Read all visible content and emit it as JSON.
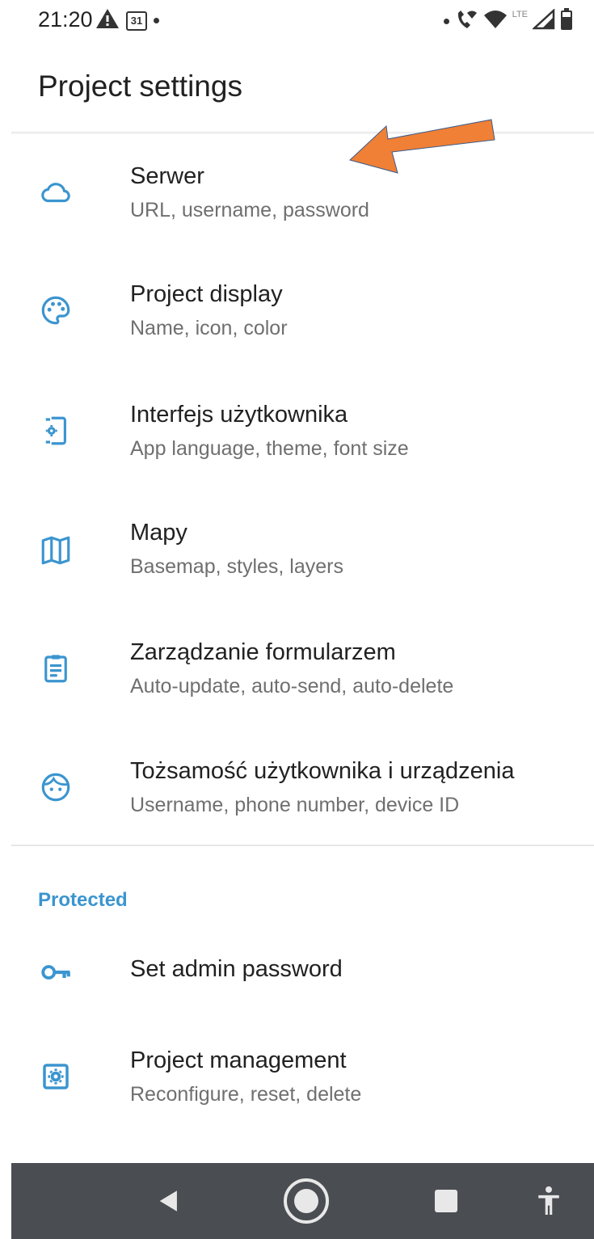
{
  "status_bar": {
    "time": "21:20",
    "calendar_day": "31",
    "left_icons": [
      "warning-icon",
      "calendar-icon",
      "notification-dot"
    ],
    "right_icons": [
      "notification-dot",
      "wifi-call-icon",
      "wifi-icon",
      "lte-signal-icon",
      "battery-icon"
    ],
    "network_label": "LTE"
  },
  "header": {
    "title": "Project settings"
  },
  "annotation": {
    "arrow_color": "#F08035",
    "icon": "orange-arrow"
  },
  "settings": [
    {
      "title": "Serwer",
      "subtitle": "URL, username, password",
      "icon": "cloud-icon"
    },
    {
      "title": "Project display",
      "subtitle": "Name, icon, color",
      "icon": "palette-icon"
    },
    {
      "title": "Interfejs użytkownika",
      "subtitle": "App language, theme, font size",
      "icon": "phone-settings-icon"
    },
    {
      "title": "Mapy",
      "subtitle": "Basemap, styles, layers",
      "icon": "map-icon"
    },
    {
      "title": "Zarządzanie formularzem",
      "subtitle": "Auto-update, auto-send, auto-delete",
      "icon": "clipboard-icon"
    },
    {
      "title": "Tożsamość użytkownika i urządzenia",
      "subtitle": "Username, phone number, device ID",
      "icon": "face-icon"
    }
  ],
  "protected": {
    "header": "Protected",
    "items": [
      {
        "title": "Set admin password",
        "icon": "key-icon"
      },
      {
        "title": "Project management",
        "subtitle": "Reconfigure, reset, delete",
        "icon": "settings-box-icon"
      }
    ]
  },
  "nav_bar": {
    "buttons": [
      "back-icon",
      "home-icon",
      "recents-icon",
      "accessibility-icon"
    ]
  },
  "colors": {
    "accent": "#3B95CF",
    "arrow": "#F08035",
    "navbar": "#4A4D51"
  }
}
